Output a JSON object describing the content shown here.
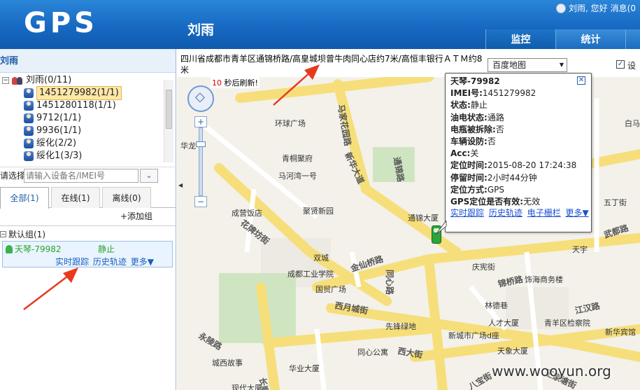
{
  "header": {
    "logo": "GPS",
    "user_title": "刘雨",
    "greeting": "刘雨, 您好",
    "messages": "消息(0",
    "nav_tabs": [
      "监控",
      "统计"
    ]
  },
  "left_panel": {
    "title": "刘雨",
    "tree": {
      "root": "刘雨(0/11)",
      "items": [
        "1451279982(1/1)",
        "1451280118(1/1)",
        "9712(1/1)",
        "9936(1/1)",
        "绥化(2/2)",
        "绥化1(3/3)"
      ]
    },
    "search": {
      "label": "请选择：",
      "placeholder": "请输入设备名/IMEI号"
    },
    "tabs": [
      "全部(1)",
      "在线(1)",
      "离线(0)"
    ],
    "add_group": "+添加组",
    "group_title": "默认组(1)",
    "vehicle": {
      "name": "天琴-79982",
      "status": "静止",
      "links": [
        "实时跟踪",
        "历史轨迹",
        "更多▼"
      ]
    }
  },
  "map": {
    "address": "四川省成都市青羊区通锦桥路/高皇城坝曾牛肉同心店约7米/高恒丰银行ＡＴＭ约8米",
    "map_type": "百度地图",
    "checkbox_label": "设",
    "banner_prefix": "",
    "banner_highlight": "10",
    "banner_suffix": "秒后刷新!",
    "watermark": "www.wooyun.org",
    "labels": [
      "环球广场",
      "马家花园路",
      "青桐聚府",
      "马河湾一号",
      "通锦路",
      "成营饭店",
      "聚贤新园",
      "通锦大厦",
      "新华大道",
      "花牌坊街",
      "金仙桥路",
      "双城",
      "成都工业学院",
      "国贸广场",
      "同心路",
      "西月城街",
      "先锋绿地",
      "同心公寓",
      "西大街",
      "华业大厦",
      "城西故事",
      "现代大厦",
      "新城市广场d座",
      "人才大厦",
      "青羊区检察院",
      "江汉路",
      "新华宾馆",
      "饰海商务楼",
      "王家塘街",
      "天象大厦",
      "武都路",
      "五丁街",
      "白马",
      "庆宪街",
      "林德巷",
      "锦桥路",
      "永陵路",
      "长顺",
      "八宝街",
      "华龙",
      "天宇"
    ],
    "popup": {
      "rows": [
        {
          "k": "天琴-79982",
          "v": ""
        },
        {
          "k": "IMEI号:",
          "v": "1451279982"
        },
        {
          "k": "状态:",
          "v": "静止"
        },
        {
          "k": "油电状态:",
          "v": "通路"
        },
        {
          "k": "电瓶被拆除:",
          "v": "否"
        },
        {
          "k": "车辆设防:",
          "v": "否"
        },
        {
          "k": "Acc:",
          "v": "关"
        },
        {
          "k": "定位时间:",
          "v": "2015-08-20 17:24:38"
        },
        {
          "k": "停留时间:",
          "v": "2小时44分钟"
        },
        {
          "k": "定位方式:",
          "v": "GPS"
        },
        {
          "k": "GPS定位是否有效:",
          "v": "无效"
        }
      ],
      "links": [
        "实时跟踪",
        "历史轨迹",
        "电子栅栏",
        "更多▼"
      ]
    }
  },
  "colors": {
    "header_blue": "#1769c2",
    "road_yellow": "#f6df7a",
    "link_blue": "#1a4fd0",
    "status_green": "#2aa52a",
    "arrow_red": "#e8391f"
  }
}
